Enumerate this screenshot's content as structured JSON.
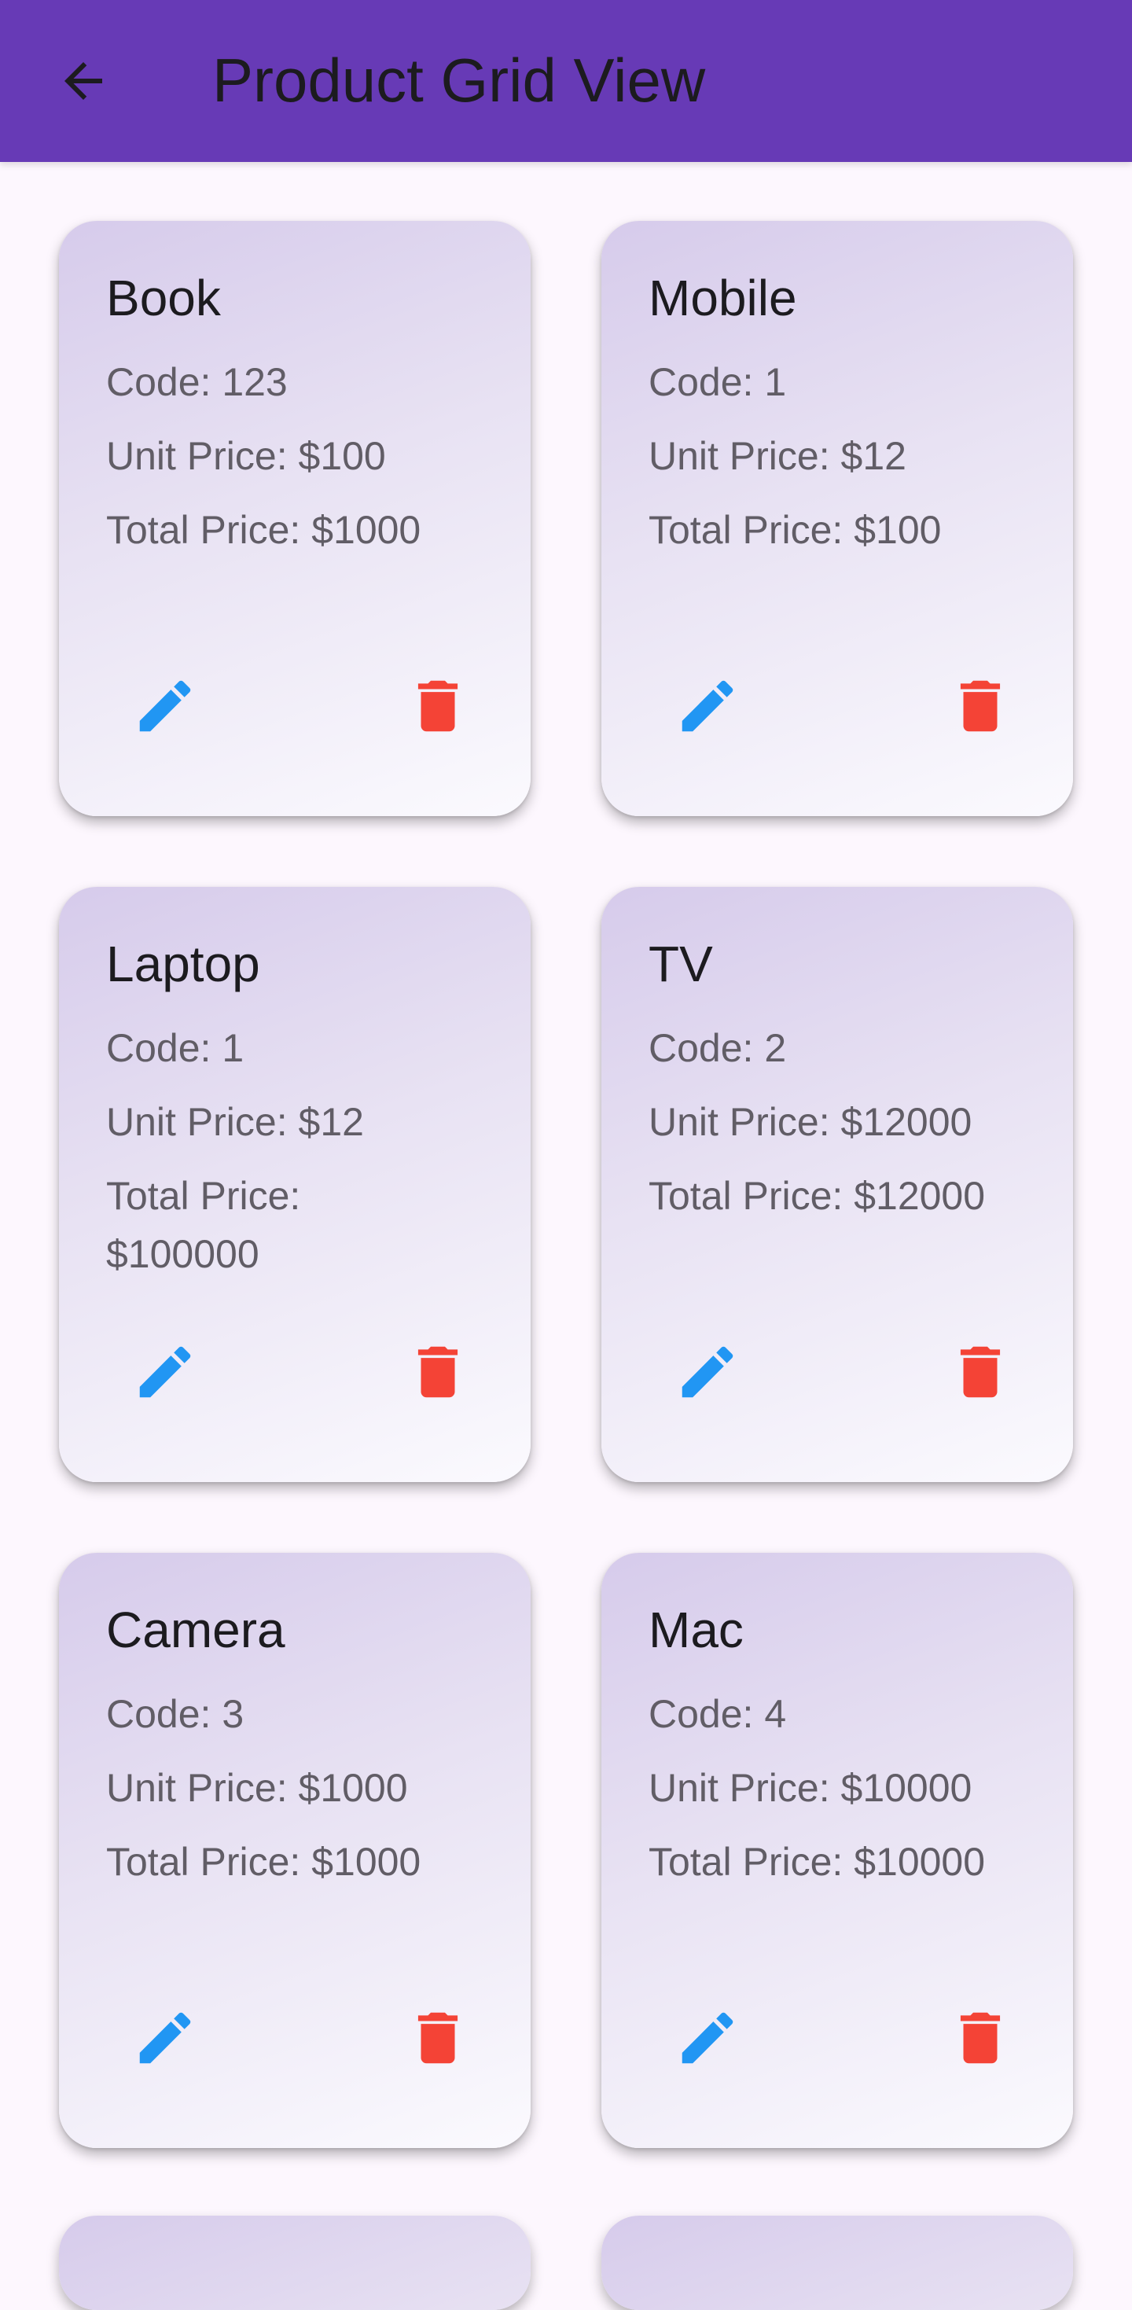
{
  "app_bar": {
    "title": "Product Grid View",
    "back_icon": "arrow-back-icon",
    "background": "#673ab6"
  },
  "products": [
    {
      "name": "Book",
      "code": "Code: 123",
      "unit_price": "Unit Price: $100",
      "total_price": "Total Price: $1000"
    },
    {
      "name": "Mobile",
      "code": "Code: 1",
      "unit_price": "Unit Price: $12",
      "total_price": "Total Price: $100"
    },
    {
      "name": "Laptop",
      "code": "Code: 1",
      "unit_price": "Unit Price: $12",
      "total_price": "Total Price: $100000"
    },
    {
      "name": "TV",
      "code": "Code: 2",
      "unit_price": "Unit Price: $12000",
      "total_price": "Total Price: $12000"
    },
    {
      "name": "Camera",
      "code": "Code: 3",
      "unit_price": "Unit Price: $1000",
      "total_price": "Total Price: $1000"
    },
    {
      "name": "Mac",
      "code": "Code: 4",
      "unit_price": "Unit Price: $10000",
      "total_price": "Total Price: $10000"
    }
  ],
  "icons": {
    "edit": "pencil-icon",
    "delete": "trash-icon"
  },
  "colors": {
    "edit": "#2196f3",
    "delete": "#f44336",
    "text_primary": "#1c1b1f",
    "text_secondary": "#615d66"
  }
}
